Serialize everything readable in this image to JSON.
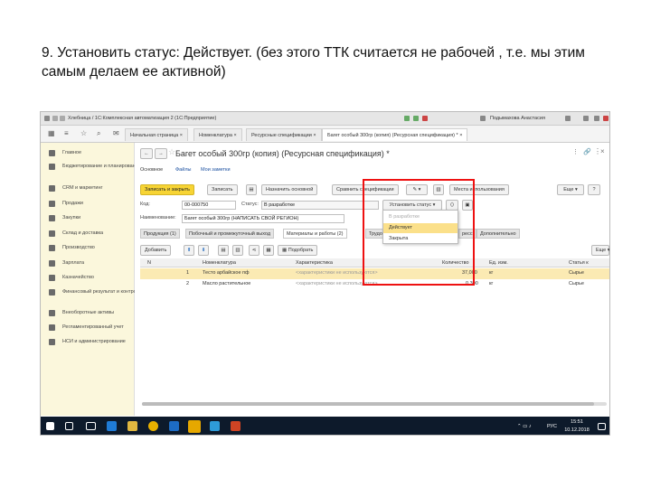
{
  "caption": "9. Установить статус: Действует. (без этого ТТК считается не рабочей , т.е. мы этим самым делаем ее активной)",
  "app": {
    "title": "Хлебница / 1С:Комплексная автоматизация 2 (1С:Предприятие)",
    "user": "Подымахова Анастасия"
  },
  "tabs": [
    {
      "label": "Начальная страница"
    },
    {
      "label": "Номенклатура"
    },
    {
      "label": "Ресурсные спецификации"
    },
    {
      "label": "Багет особый 300гр (копия) (Ресурсная спецификация) *"
    }
  ],
  "sidebar": {
    "items": [
      {
        "label": "Главное"
      },
      {
        "label": "Бюджетирование и планирование"
      },
      {
        "label": "CRM и маркетинг"
      },
      {
        "label": "Продажи"
      },
      {
        "label": "Закупки"
      },
      {
        "label": "Склад и доставка"
      },
      {
        "label": "Производство"
      },
      {
        "label": "Зарплата"
      },
      {
        "label": "Казначейство"
      },
      {
        "label": "Финансовый результат и контроллинг"
      },
      {
        "label": "Внеоборотные активы"
      },
      {
        "label": "Регламентированный учет"
      },
      {
        "label": "НСИ и администрирование"
      }
    ]
  },
  "form": {
    "title": "Багет особый 300гр (копия) (Ресурсная спецификация) *",
    "links": [
      "Основное",
      "Файлы",
      "Мои заметки"
    ],
    "toolbar": {
      "save_close": "Записать и закрыть",
      "save": "Записать",
      "set_main": "Назначить основной",
      "compare": "Сравнить спецификации",
      "usage_places": "Места использования",
      "more": "Еще",
      "help": "?"
    },
    "code_label": "Код:",
    "code_value": "00-000750",
    "status_label": "Статус:",
    "status_value": "В разработке",
    "set_status_button": "Установить статус",
    "name_label": "Наименование:",
    "name_value": "Багет особый 300гр (НАПИСАТЬ СВОЙ РЕГИОН)",
    "status_options": [
      {
        "label": "В разработке"
      },
      {
        "label": "Действует"
      },
      {
        "label": "Закрыта"
      }
    ],
    "inner_tabs": [
      {
        "label": "Продукция (1)"
      },
      {
        "label": "Побочный и промежуточный выход"
      },
      {
        "label": "Материалы и работы (2)"
      },
      {
        "label": "Трудозатр"
      },
      {
        "label": "ресс"
      },
      {
        "label": "Дополнительно"
      }
    ],
    "grid_toolbar": {
      "add": "Добавить",
      "pick": "Подобрать",
      "more": "Еще"
    },
    "grid": {
      "columns": [
        "N",
        "Номенклатура",
        "Характеристика",
        "Количество",
        "Ед. изм.",
        "Статья к"
      ],
      "rows": [
        {
          "n": "1",
          "item": "Тесто арбайское пф",
          "char": "<характеристики не используются>",
          "qty": "37,000",
          "unit": "кг",
          "article": "Сырье"
        },
        {
          "n": "2",
          "item": "Масло растительное",
          "char": "<характеристики не используются>",
          "qty": "0,300",
          "unit": "кг",
          "article": "Сырье"
        }
      ]
    }
  },
  "taskbar": {
    "lang": "РУС",
    "time": "15:51",
    "date": "10.12.2018"
  },
  "colors": {
    "accent_yellow": "#f7d434",
    "highlight_row": "#fbeab3",
    "annotation_red": "#e11111",
    "sidebar_bg": "#fbf7dc"
  }
}
